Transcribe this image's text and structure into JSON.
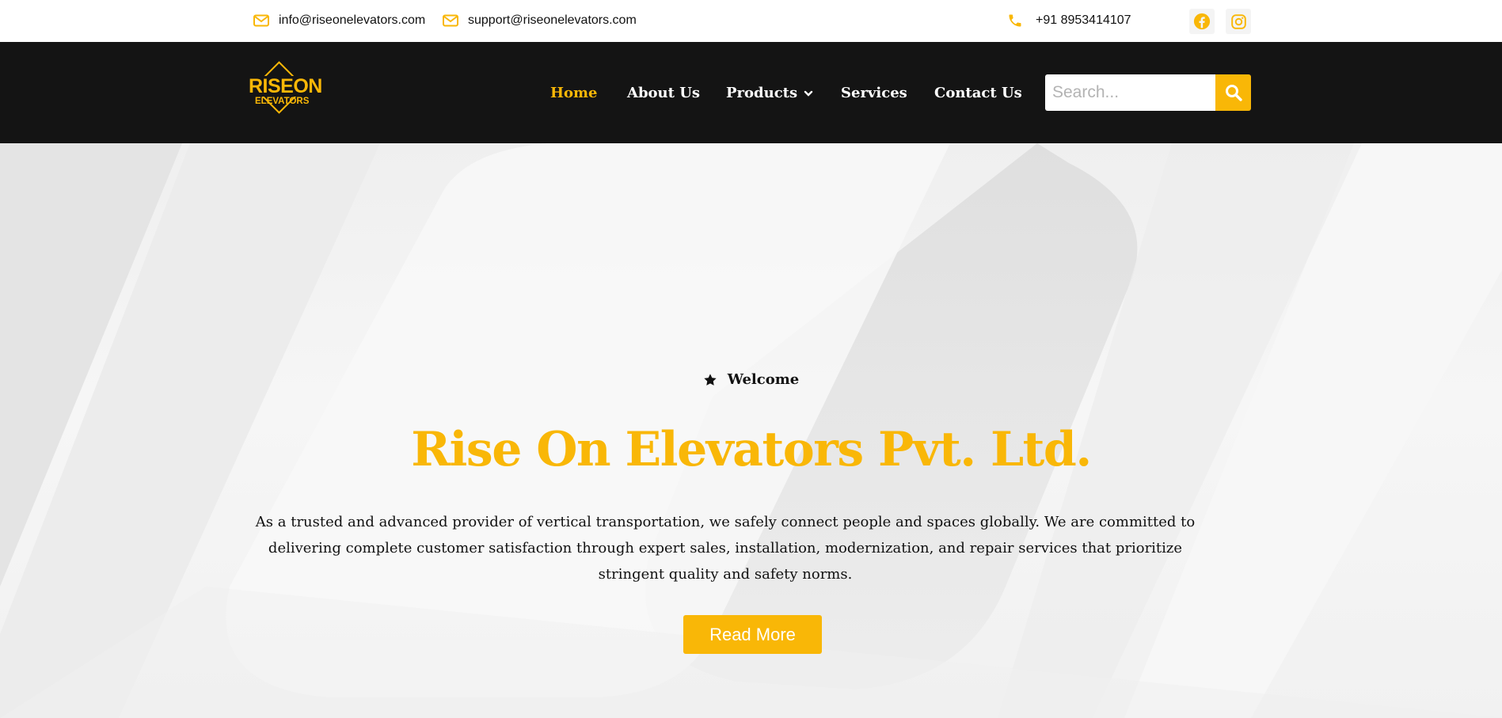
{
  "topbar": {
    "email_info": "info@riseonelevators.com",
    "email_support": "support@riseonelevators.com",
    "phone": "+91 8953414107",
    "icons": {
      "email": "envelope-icon",
      "phone": "phone-icon",
      "facebook": "facebook-icon",
      "instagram": "instagram-icon"
    }
  },
  "logo": {
    "line1": "RISEON",
    "line2": "ELEVATORS"
  },
  "nav": {
    "items": [
      {
        "label": "Home",
        "active": true
      },
      {
        "label": "About Us"
      },
      {
        "label": "Products",
        "dropdown": true
      },
      {
        "label": "Services"
      },
      {
        "label": "Contact Us"
      }
    ],
    "dropdown_icon": "chevron-down-icon"
  },
  "search": {
    "placeholder": "Search...",
    "value": "",
    "icon": "search-icon"
  },
  "hero": {
    "eyebrow": "Welcome",
    "eyebrow_icon": "star-icon",
    "title": "Rise On Elevators Pvt. Ltd.",
    "description": "As a trusted and advanced provider of vertical transportation, we safely connect people and spaces globally. We are committed to delivering complete customer satisfaction through expert sales, installation, modernization, and repair services that prioritize stringent quality and safety norms.",
    "button_label": "Read More"
  },
  "colors": {
    "accent": "#f9b707",
    "header_bg": "#141414",
    "text_dark": "#111111",
    "hero_bg": "#f3f3f3"
  }
}
